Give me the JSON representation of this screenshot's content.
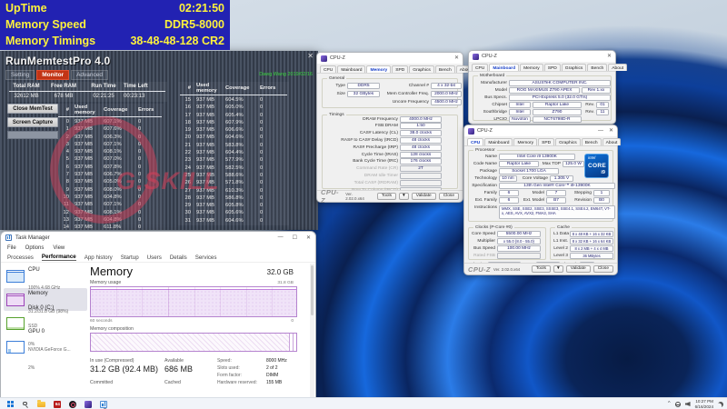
{
  "colors": {
    "overlay_bg": "#2222b2",
    "overlay_text": "#fdf23c",
    "memtest_monitor_tab": "#c23415",
    "gskill_watermark": "#d5406a",
    "taskmgr_accent": "#9b43b8",
    "cpuz_value_text": "#1c1c6e",
    "cpuz_active_tab": "#1a41c8",
    "intel_badge_blue": "#0c6fd6",
    "wallpaper_bright_blue": "#1157c8",
    "taskbar_bg": "#f1f4f9"
  },
  "overlay": {
    "rows": [
      {
        "label": "UpTime",
        "value": "02:21:50"
      },
      {
        "label": "Memory Speed",
        "value": "DDR5-8000"
      },
      {
        "label": "Memory Timings",
        "value": "38-48-48-128 CR2"
      }
    ]
  },
  "memtest": {
    "title": "RunMemtestPro 4.0",
    "close_glyph": "✕",
    "credit": "Dawg Wang 2019/02/16",
    "tabs": [
      "Setting",
      "Monitor",
      "Advanced"
    ],
    "stats": [
      {
        "label": "Total RAM",
        "value": "32612 MB"
      },
      {
        "label": "Free RAM",
        "value": "678 MB"
      },
      {
        "label": "Run Time",
        "value": "02:21:25"
      },
      {
        "label": "Time Left",
        "value": "00:23:13"
      }
    ],
    "buttons": {
      "close_memtest": "Close MemTest",
      "screen_capture": "Screen Capture"
    },
    "columns": [
      "#",
      "Used memory",
      "Coverage",
      "Errors"
    ],
    "left_rows": [
      {
        "i": "0",
        "used": "937 MB",
        "cov": "607.1%",
        "err": "0"
      },
      {
        "i": "1",
        "used": "937 MB",
        "cov": "607.6%",
        "err": "0"
      },
      {
        "i": "2",
        "used": "937 MB",
        "cov": "606.3%",
        "err": "0"
      },
      {
        "i": "3",
        "used": "937 MB",
        "cov": "607.1%",
        "err": "0"
      },
      {
        "i": "4",
        "used": "937 MB",
        "cov": "608.1%",
        "err": "0"
      },
      {
        "i": "5",
        "used": "937 MB",
        "cov": "607.0%",
        "err": "0"
      },
      {
        "i": "6",
        "used": "937 MB",
        "cov": "607.8%",
        "err": "0"
      },
      {
        "i": "7",
        "used": "937 MB",
        "cov": "606.7%",
        "err": "0"
      },
      {
        "i": "8",
        "used": "937 MB",
        "cov": "605.0%",
        "err": "0"
      },
      {
        "i": "9",
        "used": "937 MB",
        "cov": "608.0%",
        "err": "0"
      },
      {
        "i": "10",
        "used": "937 MB",
        "cov": "604.8%",
        "err": "0"
      },
      {
        "i": "11",
        "used": "937 MB",
        "cov": "607.1%",
        "err": "0"
      },
      {
        "i": "12",
        "used": "937 MB",
        "cov": "608.1%",
        "err": "0"
      },
      {
        "i": "13",
        "used": "937 MB",
        "cov": "604.8%",
        "err": "0"
      },
      {
        "i": "14",
        "used": "937 MB",
        "cov": "611.8%",
        "err": "0"
      }
    ],
    "right_rows": [
      {
        "i": "15",
        "used": "937 MB",
        "cov": "604.5%",
        "err": "0"
      },
      {
        "i": "16",
        "used": "937 MB",
        "cov": "605.0%",
        "err": "0"
      },
      {
        "i": "17",
        "used": "937 MB",
        "cov": "605.4%",
        "err": "0"
      },
      {
        "i": "18",
        "used": "937 MB",
        "cov": "607.9%",
        "err": "0"
      },
      {
        "i": "19",
        "used": "937 MB",
        "cov": "606.6%",
        "err": "0"
      },
      {
        "i": "20",
        "used": "937 MB",
        "cov": "604.6%",
        "err": "0"
      },
      {
        "i": "21",
        "used": "937 MB",
        "cov": "583.8%",
        "err": "0"
      },
      {
        "i": "22",
        "used": "937 MB",
        "cov": "604.4%",
        "err": "0"
      },
      {
        "i": "23",
        "used": "937 MB",
        "cov": "577.9%",
        "err": "0"
      },
      {
        "i": "24",
        "used": "937 MB",
        "cov": "582.5%",
        "err": "0"
      },
      {
        "i": "25",
        "used": "937 MB",
        "cov": "588.6%",
        "err": "0"
      },
      {
        "i": "26",
        "used": "937 MB",
        "cov": "571.8%",
        "err": "0"
      },
      {
        "i": "27",
        "used": "937 MB",
        "cov": "610.3%",
        "err": "0"
      },
      {
        "i": "28",
        "used": "937 MB",
        "cov": "586.8%",
        "err": "0"
      },
      {
        "i": "29",
        "used": "937 MB",
        "cov": "605.8%",
        "err": "0"
      },
      {
        "i": "30",
        "used": "937 MB",
        "cov": "605.6%",
        "err": "0"
      },
      {
        "i": "31",
        "used": "937 MB",
        "cov": "604.6%",
        "err": "0"
      }
    ],
    "watermark": "G.SKILL"
  },
  "cpuz": {
    "title": "CPU-Z",
    "tabs": [
      "CPU",
      "Mainboard",
      "Memory",
      "SPD",
      "Graphics",
      "Bench",
      "About"
    ],
    "caption": {
      "min": "—",
      "close": "✕"
    },
    "footer": {
      "brand": "CPU-Z",
      "version": "Ver. 2.02.0.x64",
      "tools": "Tools",
      "arrow": "▼",
      "validate": "Validate",
      "close": "Close"
    }
  },
  "cpuz_memory": {
    "group_general": "General",
    "group_timings": "Timings",
    "type_label": "Type",
    "type": "DDR5",
    "channel_label": "Channel #",
    "channel": "4 x 32-bit",
    "size_label": "Size",
    "size": "32 GBytes",
    "mcf_label": "Mem Controller Freq.",
    "mcf": "2000.0 MHz",
    "uncore_label": "Uncore Frequency",
    "uncore": "4500.0 MHz",
    "timings": [
      {
        "label": "DRAM Frequency",
        "value": "4000.0 MHz"
      },
      {
        "label": "FSB:DRAM",
        "value": "1:50"
      },
      {
        "label": "CAS# Latency (CL)",
        "value": "38.0 clocks"
      },
      {
        "label": "RAS# to CAS# Delay (tRCD)",
        "value": "48 clocks"
      },
      {
        "label": "RAS# Precharge (tRP)",
        "value": "48 clocks"
      },
      {
        "label": "Cycle Time (tRAS)",
        "value": "128 clocks"
      },
      {
        "label": "Bank Cycle Time (tRC)",
        "value": "176 clocks"
      },
      {
        "label": "Command Rate (CR)",
        "value": "2T"
      },
      {
        "label": "DRAM Idle Timer",
        "value": ""
      },
      {
        "label": "Total CAS# (tRDRAM)",
        "value": ""
      },
      {
        "label": "Row To Column (tRCD)",
        "value": ""
      }
    ]
  },
  "cpuz_mainboard": {
    "group": "Motherboard",
    "manufacturer_label": "Manufacturer",
    "manufacturer": "ASUSTeK COMPUTER INC.",
    "model_label": "Model",
    "model": "ROG MAXIMUS Z790 APEX",
    "model_rev": "Rev 1.xx",
    "bus_label": "Bus Specs.",
    "bus": "PCI-Express 5.0 (32.0 GT/s)",
    "chipset_label": "Chipset",
    "chipset_brand": "Intel",
    "chipset": "Raptor Lake",
    "rev_label": "Rev.",
    "chipset_rev": "01",
    "southbridge_label": "Southbridge",
    "southbridge_brand": "Intel",
    "southbridge": "Z790",
    "southbridge_rev": "11",
    "lpcio_label": "LPCIO",
    "lpcio_brand": "Nuvoton",
    "lpcio": "NCT6798D-R"
  },
  "cpuz_cpu": {
    "group": "Processor",
    "name_label": "Name",
    "name": "Intel Core i9 13900K",
    "codename_label": "Code Name",
    "codename": "Raptor Lake",
    "tdp_label": "Max TDP",
    "tdp": "125.0 W",
    "package_label": "Package",
    "package": "Socket 1700 LGA",
    "tech_label": "Technology",
    "tech": "10 nm",
    "voltage_label": "Core Voltage",
    "voltage": "1.305 V",
    "spec_label": "Specification",
    "spec": "13th Gen Intel® Core™ i9-13900K",
    "family_label": "Family",
    "family": "6",
    "model_label": "Model",
    "model": "7",
    "stepping_label": "Stepping",
    "stepping": "1",
    "extfamily_label": "Ext. Family",
    "extfamily": "6",
    "extmodel_label": "Ext. Model",
    "extmodel": "B7",
    "revision_label": "Revision",
    "revision": "B0",
    "instructions_label": "Instructions",
    "instructions": "MMX, SSE, SSE2, SSE3, SSSE3, SSE4.1, SSE4.2, EM64T, VT-x, AES, AVX, AVX2, FMA3, SHA",
    "badge": {
      "brand": "intel",
      "line": "CORE",
      "tier": "i9"
    },
    "clocks_group": "Clocks (P-Core #0)",
    "core_speed_label": "Core Speed",
    "core_speed": "5500.00 MHz",
    "multiplier_label": "Multiplier",
    "multiplier": "x 55.0 (8.0 - 55.0)",
    "bus_speed_label": "Bus Speed",
    "bus_speed": "100.00 MHz",
    "rated_fsb_label": "Rated FSB",
    "rated_fsb": "",
    "cache_group": "Cache",
    "l1d_label": "L1 Data",
    "l1d": "8 x 48 KB + 16 x 32 KB",
    "l1i_label": "L1 Inst.",
    "l1i": "8 x 32 KB + 16 x 64 KB",
    "l2_label": "Level 2",
    "l2": "8 x 2 MB + 4 x 4 MB",
    "l3_label": "Level 3",
    "l3": "36 MBytes",
    "selection_label": "Selection",
    "selection": "Socket #1",
    "drop_arrow": "▼",
    "cores_label": "Cores",
    "cores": "8P + 16E",
    "threads_label": "Threads",
    "threads": "32"
  },
  "taskmgr": {
    "title": "Task Manager",
    "caption": {
      "min": "—",
      "max": "☐",
      "close": "✕"
    },
    "menu": [
      "File",
      "Options",
      "View"
    ],
    "tabs": [
      "Processes",
      "Performance",
      "App history",
      "Startup",
      "Users",
      "Details",
      "Services"
    ],
    "sidebar": [
      {
        "name": "CPU",
        "line1": "100% 4.68 GHz",
        "line2": ""
      },
      {
        "name": "Memory",
        "line1": "31.2/31.8 GB (98%)",
        "line2": ""
      },
      {
        "name": "Disk 0 (C:)",
        "line1": "SSD",
        "line2": "0%"
      },
      {
        "name": "GPU 0",
        "line1": "NVIDIA GeForce G...",
        "line2": "2%"
      }
    ],
    "main": {
      "title": "Memory",
      "capacity": "32.0 GB",
      "usage_label": "Memory usage",
      "graph_max": "31.8 GB",
      "graph_min": "0",
      "timescale": "60 seconds",
      "composition_label": "Memory composition",
      "inuse_label": "In use (Compressed)",
      "inuse": "31.2 GB (92.4 MB)",
      "available_label": "Available",
      "available": "686 MB",
      "committed_label": "Committed",
      "cached_label": "Cached",
      "details": [
        {
          "label": "Speed:",
          "value": "8000 MHz"
        },
        {
          "label": "Slots used:",
          "value": "2 of 2"
        },
        {
          "label": "Form factor:",
          "value": "DIMM"
        },
        {
          "label": "Hardware reserved:",
          "value": "155 MB"
        }
      ]
    }
  },
  "taskbar": {
    "memtest64_label": "64",
    "chevron": "^",
    "time": "10:27 PM",
    "date": "6/16/2024"
  }
}
